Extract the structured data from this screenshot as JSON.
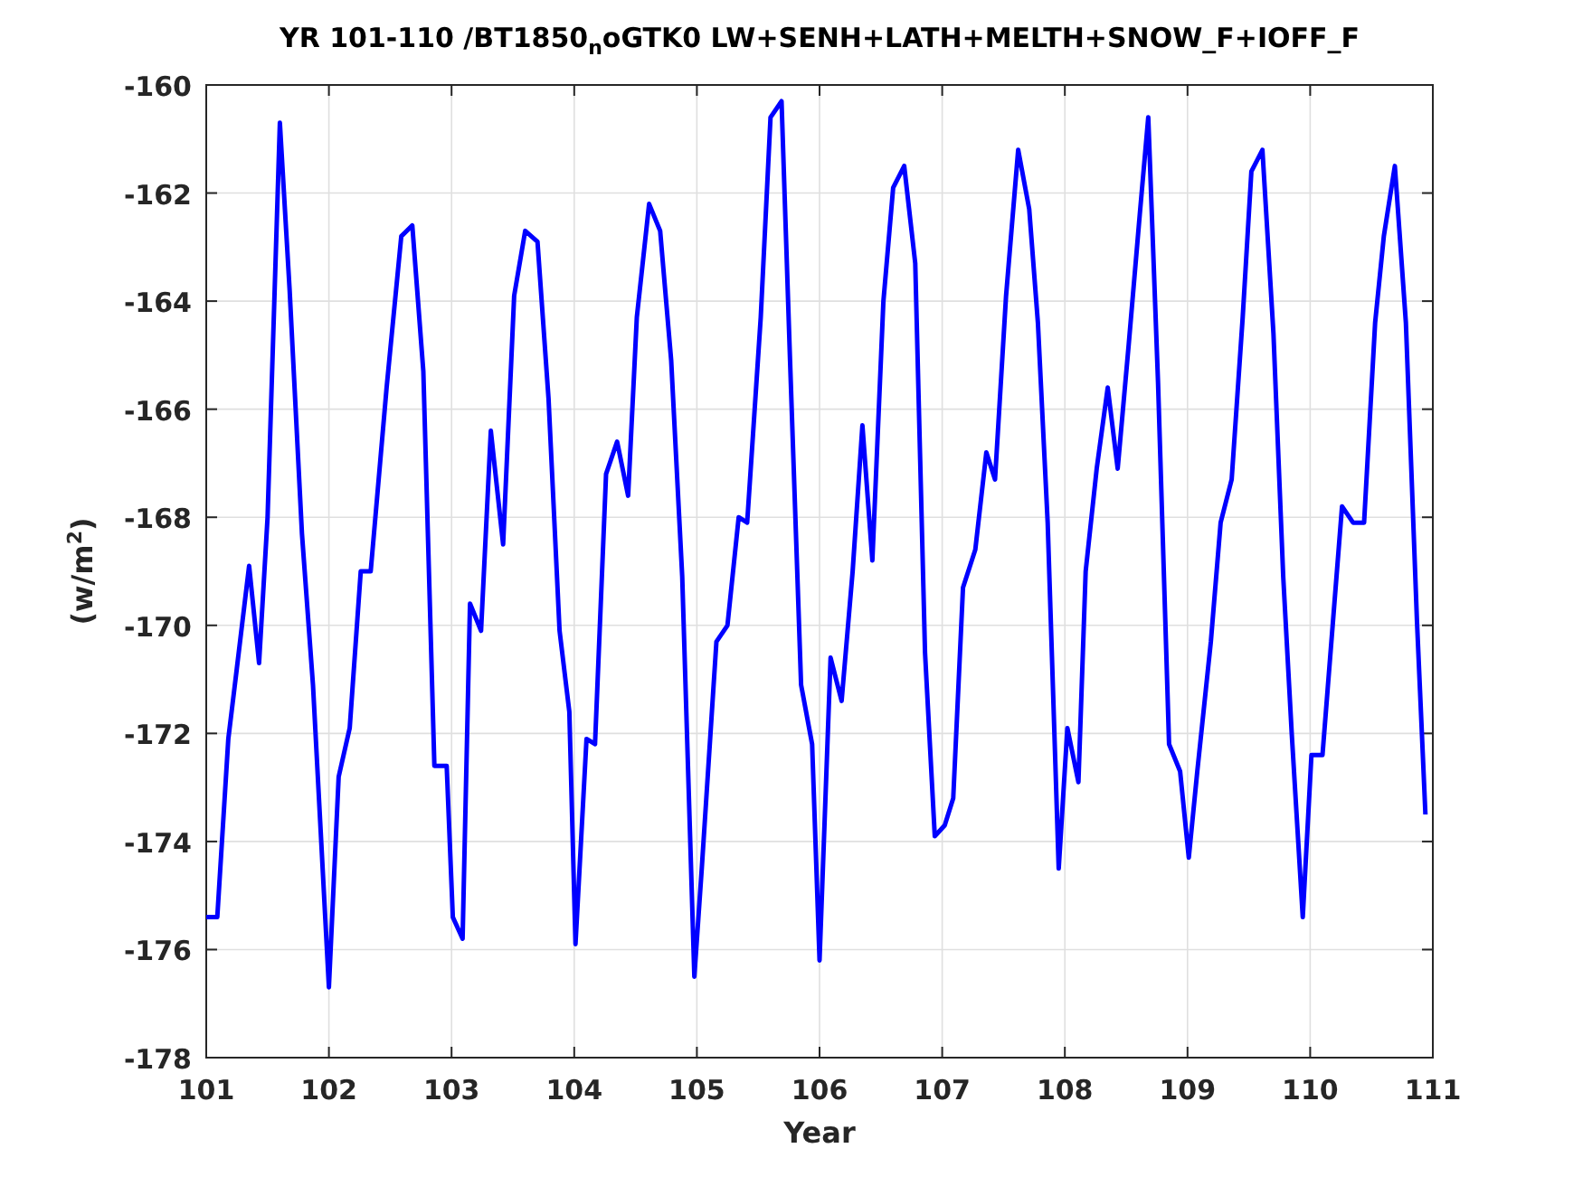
{
  "figure": {
    "title": "YR 101-110 /BT1850$_{n}$oGTK0 LW+SENH+LATH+MELTH+SNOW_F+IOFF_F",
    "chart_data": {
      "type": "line",
      "xlabel": "Year",
      "ylabel": "(w/m$^{2}$)",
      "xlim": [
        101,
        111
      ],
      "ylim": [
        -178,
        -160
      ],
      "grid": true,
      "xticks": [
        101,
        102,
        103,
        104,
        105,
        106,
        107,
        108,
        109,
        110,
        111
      ],
      "yticks": [
        -178,
        -176,
        -174,
        -172,
        -170,
        -168,
        -166,
        -164,
        -162,
        -160
      ],
      "x": [
        101.0,
        101.09,
        101.18,
        101.25,
        101.35,
        101.43,
        101.5,
        101.6,
        101.68,
        101.78,
        101.87,
        102.0,
        102.08,
        102.17,
        102.26,
        102.34,
        102.47,
        102.59,
        102.68,
        102.77,
        102.86,
        102.96,
        103.01,
        103.09,
        103.15,
        103.24,
        103.32,
        103.42,
        103.51,
        103.6,
        103.7,
        103.79,
        103.88,
        103.96,
        104.01,
        104.1,
        104.17,
        104.26,
        104.35,
        104.44,
        104.51,
        104.61,
        104.7,
        104.79,
        104.88,
        104.98,
        105.04,
        105.16,
        105.25,
        105.34,
        105.41,
        105.52,
        105.6,
        105.69,
        105.76,
        105.85,
        105.94,
        106.0,
        106.09,
        106.18,
        106.27,
        106.35,
        106.43,
        106.52,
        106.6,
        106.69,
        106.78,
        106.86,
        106.94,
        107.02,
        107.09,
        107.17,
        107.27,
        107.36,
        107.43,
        107.52,
        107.62,
        107.71,
        107.78,
        107.86,
        107.95,
        108.02,
        108.11,
        108.17,
        108.26,
        108.35,
        108.43,
        108.52,
        108.61,
        108.68,
        108.76,
        108.85,
        108.94,
        109.01,
        109.08,
        109.19,
        109.27,
        109.36,
        109.45,
        109.52,
        109.61,
        109.7,
        109.78,
        109.85,
        109.94,
        110.01,
        110.1,
        110.19,
        110.26,
        110.35,
        110.44,
        110.53,
        110.6,
        110.69,
        110.78,
        110.87,
        110.94
      ],
      "series": [
        {
          "color": "#0000ff",
          "values": [
            -175.4,
            -175.4,
            -172.1,
            -170.8,
            -168.9,
            -170.7,
            -168.0,
            -160.7,
            -163.8,
            -168.3,
            -171.1,
            -176.7,
            -172.8,
            -171.9,
            -169.0,
            -169.0,
            -165.6,
            -162.8,
            -162.6,
            -165.3,
            -172.6,
            -172.6,
            -175.4,
            -175.8,
            -169.6,
            -170.1,
            -166.4,
            -168.5,
            -163.9,
            -162.7,
            -162.9,
            -165.8,
            -170.1,
            -171.6,
            -175.9,
            -172.1,
            -172.2,
            -167.2,
            -166.6,
            -167.6,
            -164.3,
            -162.2,
            -162.7,
            -165.1,
            -169.1,
            -176.5,
            -174.5,
            -170.3,
            -170.0,
            -168.0,
            -168.1,
            -164.3,
            -160.6,
            -160.3,
            -165.1,
            -171.1,
            -172.2,
            -176.2,
            -170.6,
            -171.4,
            -169.0,
            -166.3,
            -168.8,
            -164.0,
            -161.9,
            -161.5,
            -163.3,
            -170.5,
            -173.9,
            -173.7,
            -173.2,
            -169.3,
            -168.6,
            -166.8,
            -167.3,
            -163.9,
            -161.2,
            -162.3,
            -164.4,
            -168.1,
            -174.5,
            -171.9,
            -172.9,
            -169.0,
            -167.1,
            -165.6,
            -167.1,
            -164.8,
            -162.4,
            -160.6,
            -165.5,
            -172.2,
            -172.7,
            -174.3,
            -172.7,
            -170.3,
            -168.1,
            -167.3,
            -164.3,
            -161.6,
            -161.2,
            -164.6,
            -169.1,
            -172.0,
            -175.4,
            -172.4,
            -172.4,
            -169.8,
            -167.8,
            -168.1,
            -168.1,
            -164.4,
            -162.8,
            -161.5,
            -164.4,
            -169.9,
            -173.5
          ]
        }
      ]
    }
  }
}
